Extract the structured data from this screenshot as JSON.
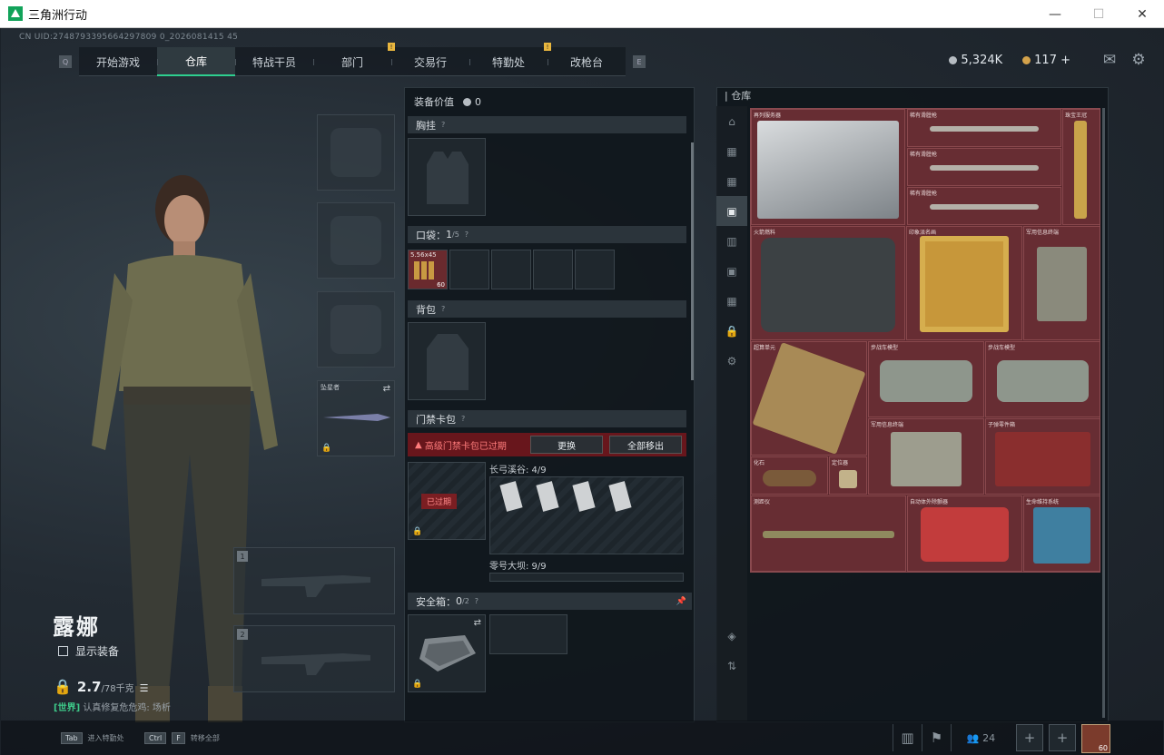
{
  "window": {
    "title": "三角洲行动",
    "minimize": "—",
    "maximize": "☐",
    "close": "✕"
  },
  "uid": "CN UID:2748793395664297809 0_2026081415 45",
  "nav": {
    "tabs": [
      {
        "label": "开始游戏"
      },
      {
        "label": "仓库",
        "active": true
      },
      {
        "label": "特战干员"
      },
      {
        "label": "部门",
        "pin": "!"
      },
      {
        "label": "交易行"
      },
      {
        "label": "特勤处",
        "pin": "!"
      },
      {
        "label": "改枪台"
      }
    ],
    "left_key": "Q",
    "right_key": "E"
  },
  "currency": {
    "silver": "5,324K",
    "gold": "117 +"
  },
  "character": {
    "name": "露娜",
    "show_equipment": "显示装备",
    "weight": "2.7",
    "weight_max": "/78千克",
    "chat_channel": "[世界]",
    "chat_text": " 认真修复危危鸡: 场析"
  },
  "equip_slots": {
    "melee_label": "坠星者",
    "weapon1": "1",
    "weapon2": "2"
  },
  "equip_panel": {
    "title": "装备价值",
    "value": "0",
    "sections": {
      "vest": "胸挂",
      "pocket": "口袋",
      "pocket_count": "1",
      "pocket_max": "/5",
      "backpack": "背包",
      "keycard": "门禁卡包",
      "safebox": "安全箱",
      "safebox_count": "0",
      "safebox_max": "/2"
    },
    "ammo": {
      "label": "5.56x45",
      "count": "60"
    },
    "warning": "高级门禁卡包已过期",
    "replace_btn": "更换",
    "remove_all_btn": "全部移出",
    "expired_tag": "已过期",
    "card1": "长弓溪谷: 4/9",
    "card2": "零号大坝: 9/9"
  },
  "warehouse": {
    "title": "仓库",
    "items": [
      {
        "label": "再列服务器"
      },
      {
        "label": "稀有滑膛枪"
      },
      {
        "label": "稀有滑膛枪"
      },
      {
        "label": "稀有滑膛枪"
      },
      {
        "label": "珠宝王冠"
      },
      {
        "label": "火箭燃料"
      },
      {
        "label": "印象派名画"
      },
      {
        "label": "军用信息终端"
      },
      {
        "label": "超算单元"
      },
      {
        "label": "步战车模型"
      },
      {
        "label": "步战车模型"
      },
      {
        "label": "军用信息终端"
      },
      {
        "label": "子弹零件箱"
      },
      {
        "label": "化石"
      },
      {
        "label": "定位器"
      },
      {
        "label": "测距仪"
      },
      {
        "label": "自动体外除颤器"
      },
      {
        "label": "生命维持系统"
      }
    ]
  },
  "bottom": {
    "tab_key": "Tab",
    "tab_text": "进入特勤处",
    "ctrl_key": "Ctrl",
    "f_key": "F",
    "ctrl_text": "转移全部",
    "friends": "24",
    "avatar_level": "60"
  }
}
